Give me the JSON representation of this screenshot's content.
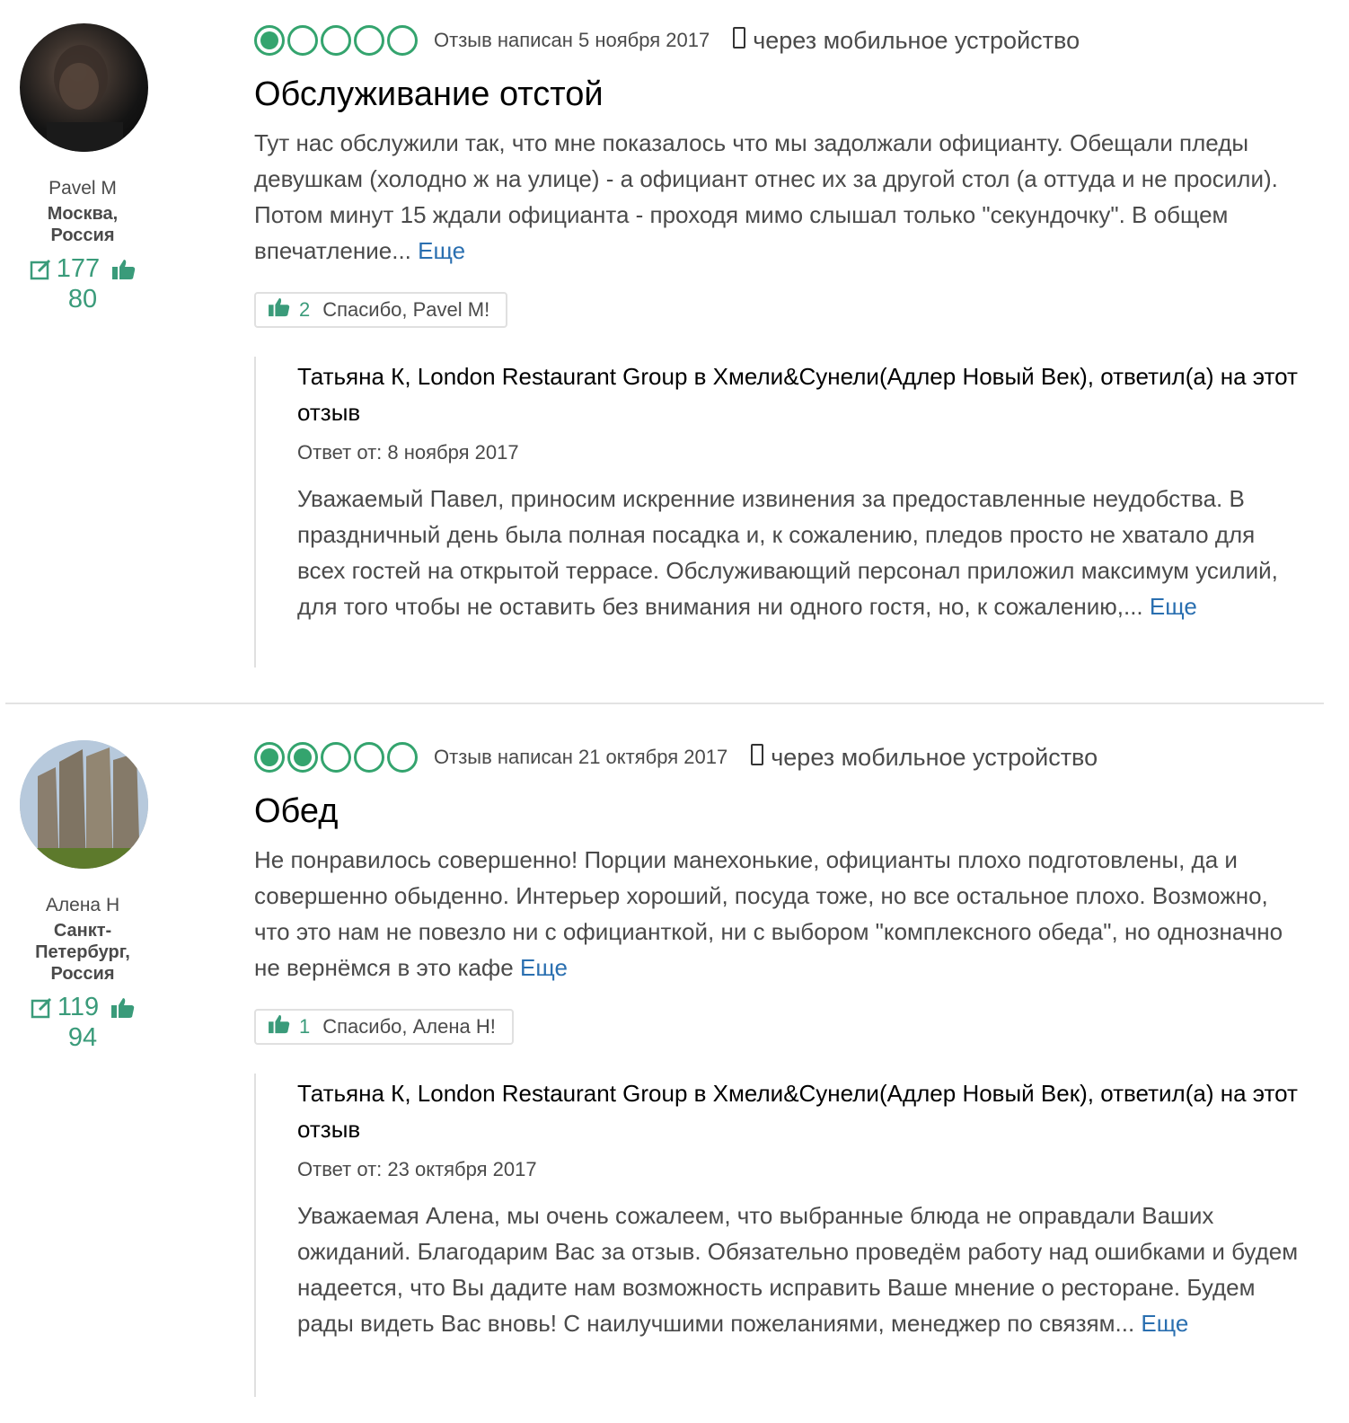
{
  "colors": {
    "accent_green": "#34a46e",
    "link_blue": "#2a6fb0"
  },
  "reviews": [
    {
      "user": {
        "name": "Pavel M",
        "location": "Москва, Россия",
        "reviews_count": "177",
        "helpful_count": "80"
      },
      "rating": 1,
      "date": "Отзыв написан 5 ноября 2017",
      "via": "через мобильное устройство",
      "title": "Обслуживание отстой",
      "text": "Тут нас обслужили так, что мне показалось что мы задолжали официанту. Обещали пледы девушкам (холодно ж на улице) - а официант отнес их за другой стол (а оттуда и не просили). Потом минут 15 ждали официанта - проходя мимо слышал только \"секундочку\". В общем впечатление...",
      "more": "Еще",
      "thanks_count": "2",
      "thanks_label": "Спасибо, Pavel M!",
      "response": {
        "header": "Татьяна К, London Restaurant Group в Хмели&Сунели(Адлер Новый Век), ответил(а) на этот отзыв",
        "date": "Ответ от: 8 ноября 2017",
        "text": "Уважаемый Павел, приносим искренние извинения за предоставленные неудобства. В праздничный день была полная посадка и, к сожалению, пледов просто не хватало для всех гостей на открытой террасе. Обслуживающий персонал приложил максимум усилий, для того чтобы не оставить без внимания ни одного гостя, но, к сожалению,...",
        "more": "Еще"
      }
    },
    {
      "user": {
        "name": "Алена Н",
        "location": "Санкт-Петербург, Россия",
        "reviews_count": "119",
        "helpful_count": "94"
      },
      "rating": 2,
      "date": "Отзыв написан 21 октября 2017",
      "via": "через мобильное устройство",
      "title": "Обед",
      "text": "Не понравилось совершенно! Порции манехонькие, официанты плохо подготовлены, да и совершенно обыденно. Интерьер хороший, посуда тоже, но все остальное плохо. Возможно, что это нам не повезло ни с официанткой, ни с выбором \"комплексного обеда\", но однозначно не вернёмся в это кафе",
      "more": "Еще",
      "thanks_count": "1",
      "thanks_label": "Спасибо, Алена Н!",
      "response": {
        "header": "Татьяна К, London Restaurant Group в Хмели&Сунели(Адлер Новый Век), ответил(а) на этот отзыв",
        "date": "Ответ от: 23 октября 2017",
        "text": "Уважаемая Алена, мы очень сожалеем, что выбранные блюда не оправдали Ваших ожиданий. Благодарим Вас за отзыв. Обязательно проведём работу над ошибками и будем надеется, что Вы дадите нам возможность исправить Ваше мнение о ресторане. Будем рады видеть Вас вновь! С наилучшими пожеланиями, менеджер по связям...",
        "more": "Еще"
      }
    }
  ]
}
